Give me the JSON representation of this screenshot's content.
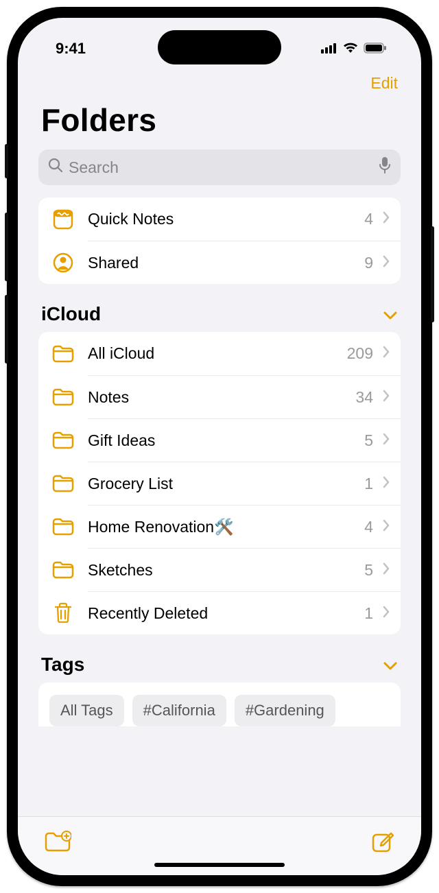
{
  "status": {
    "time": "9:41"
  },
  "nav": {
    "edit": "Edit"
  },
  "header": {
    "title": "Folders"
  },
  "search": {
    "placeholder": "Search"
  },
  "top_items": [
    {
      "label": "Quick Notes",
      "count": "4",
      "icon": "quicknote"
    },
    {
      "label": "Shared",
      "count": "9",
      "icon": "shared"
    }
  ],
  "sections": {
    "icloud": {
      "title": "iCloud",
      "items": [
        {
          "label": "All iCloud",
          "count": "209",
          "icon": "folder"
        },
        {
          "label": "Notes",
          "count": "34",
          "icon": "folder"
        },
        {
          "label": "Gift Ideas",
          "count": "5",
          "icon": "folder"
        },
        {
          "label": "Grocery List",
          "count": "1",
          "icon": "folder"
        },
        {
          "label": "Home Renovation🛠️",
          "count": "4",
          "icon": "folder"
        },
        {
          "label": "Sketches",
          "count": "5",
          "icon": "folder"
        },
        {
          "label": "Recently Deleted",
          "count": "1",
          "icon": "trash"
        }
      ]
    },
    "tags": {
      "title": "Tags",
      "chips": [
        "All Tags",
        "#California",
        "#Gardening"
      ]
    }
  }
}
